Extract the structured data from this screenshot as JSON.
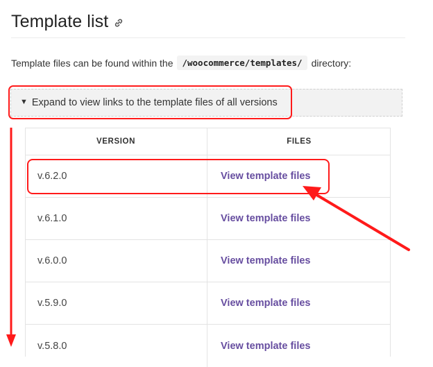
{
  "heading": {
    "title": "Template list",
    "link_icon": "link-icon"
  },
  "intro": {
    "before": "Template files can be found within the",
    "code": "/woocommerce/templates/",
    "after": "directory:"
  },
  "details": {
    "summary": "Expand to view links to the template files of all versions",
    "toggle_glyph": "▼"
  },
  "table": {
    "headers": [
      "VERSION",
      "FILES"
    ],
    "rows": [
      {
        "version": "v.6.2.0",
        "link": "View template files"
      },
      {
        "version": "v.6.1.0",
        "link": "View template files"
      },
      {
        "version": "v.6.0.0",
        "link": "View template files"
      },
      {
        "version": "v.5.9.0",
        "link": "View template files"
      },
      {
        "version": "v.5.8.0",
        "link": "View template files"
      }
    ]
  },
  "colors": {
    "link": "#674ea0",
    "annotation": "#ff1a1a",
    "summary_bg": "#f2f2f2"
  }
}
